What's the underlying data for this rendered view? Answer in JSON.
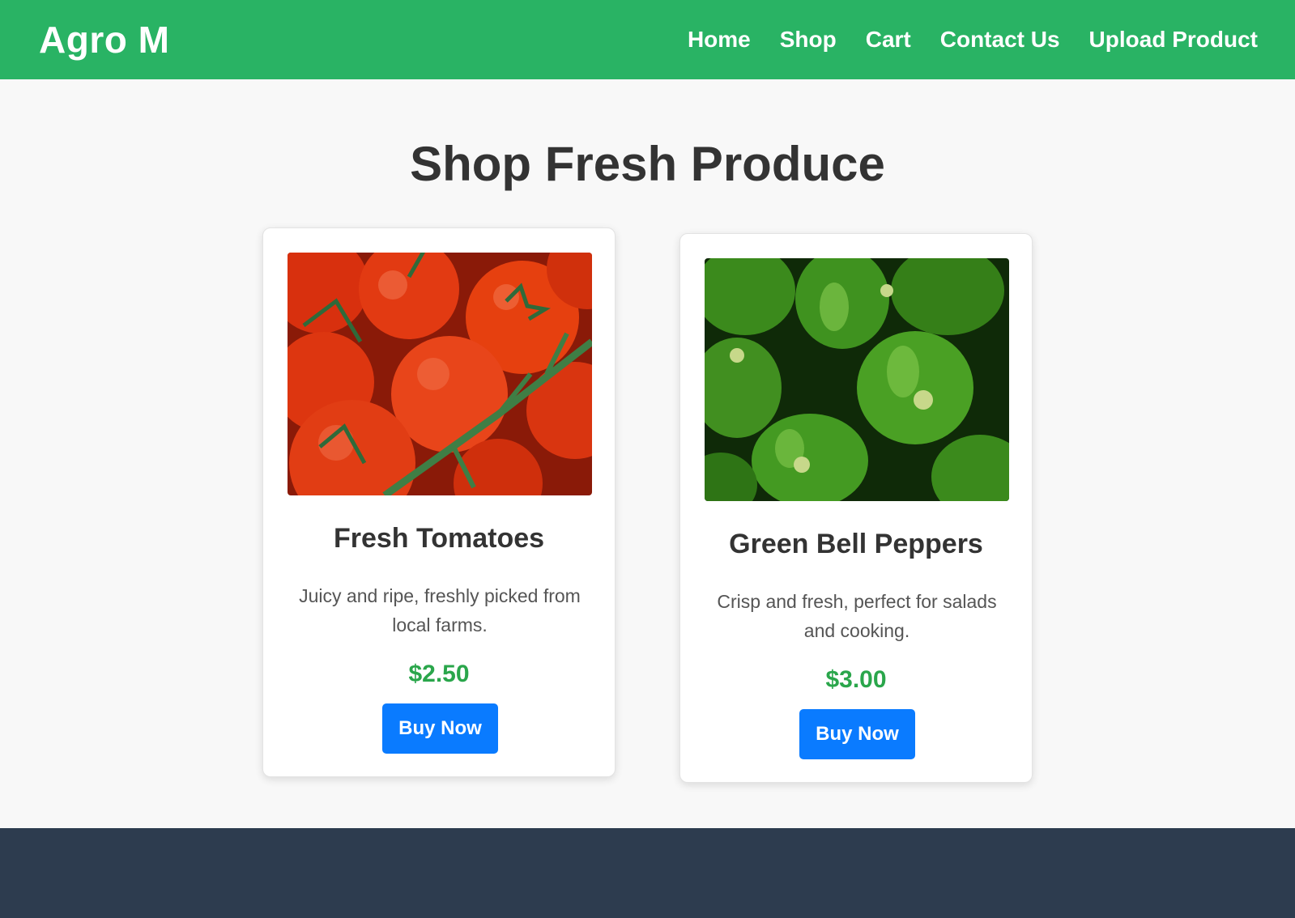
{
  "header": {
    "logo": "Agro M",
    "nav": [
      "Home",
      "Shop",
      "Cart",
      "Contact Us",
      "Upload Product"
    ]
  },
  "main": {
    "title": "Shop Fresh Produce",
    "products": [
      {
        "name": "Fresh Tomatoes",
        "description": "Juicy and ripe, freshly picked from local farms.",
        "price": "$2.50",
        "button": "Buy Now",
        "image": "tomatoes-photo"
      },
      {
        "name": "Green Bell Peppers",
        "description": "Crisp and fresh, perfect for salads and cooking.",
        "price": "$3.00",
        "button": "Buy Now",
        "image": "green-peppers-photo"
      }
    ]
  },
  "colors": {
    "navbar": "#29b364",
    "price": "#2aa64b",
    "button": "#0a7bff",
    "footer": "#2d3c4f"
  }
}
